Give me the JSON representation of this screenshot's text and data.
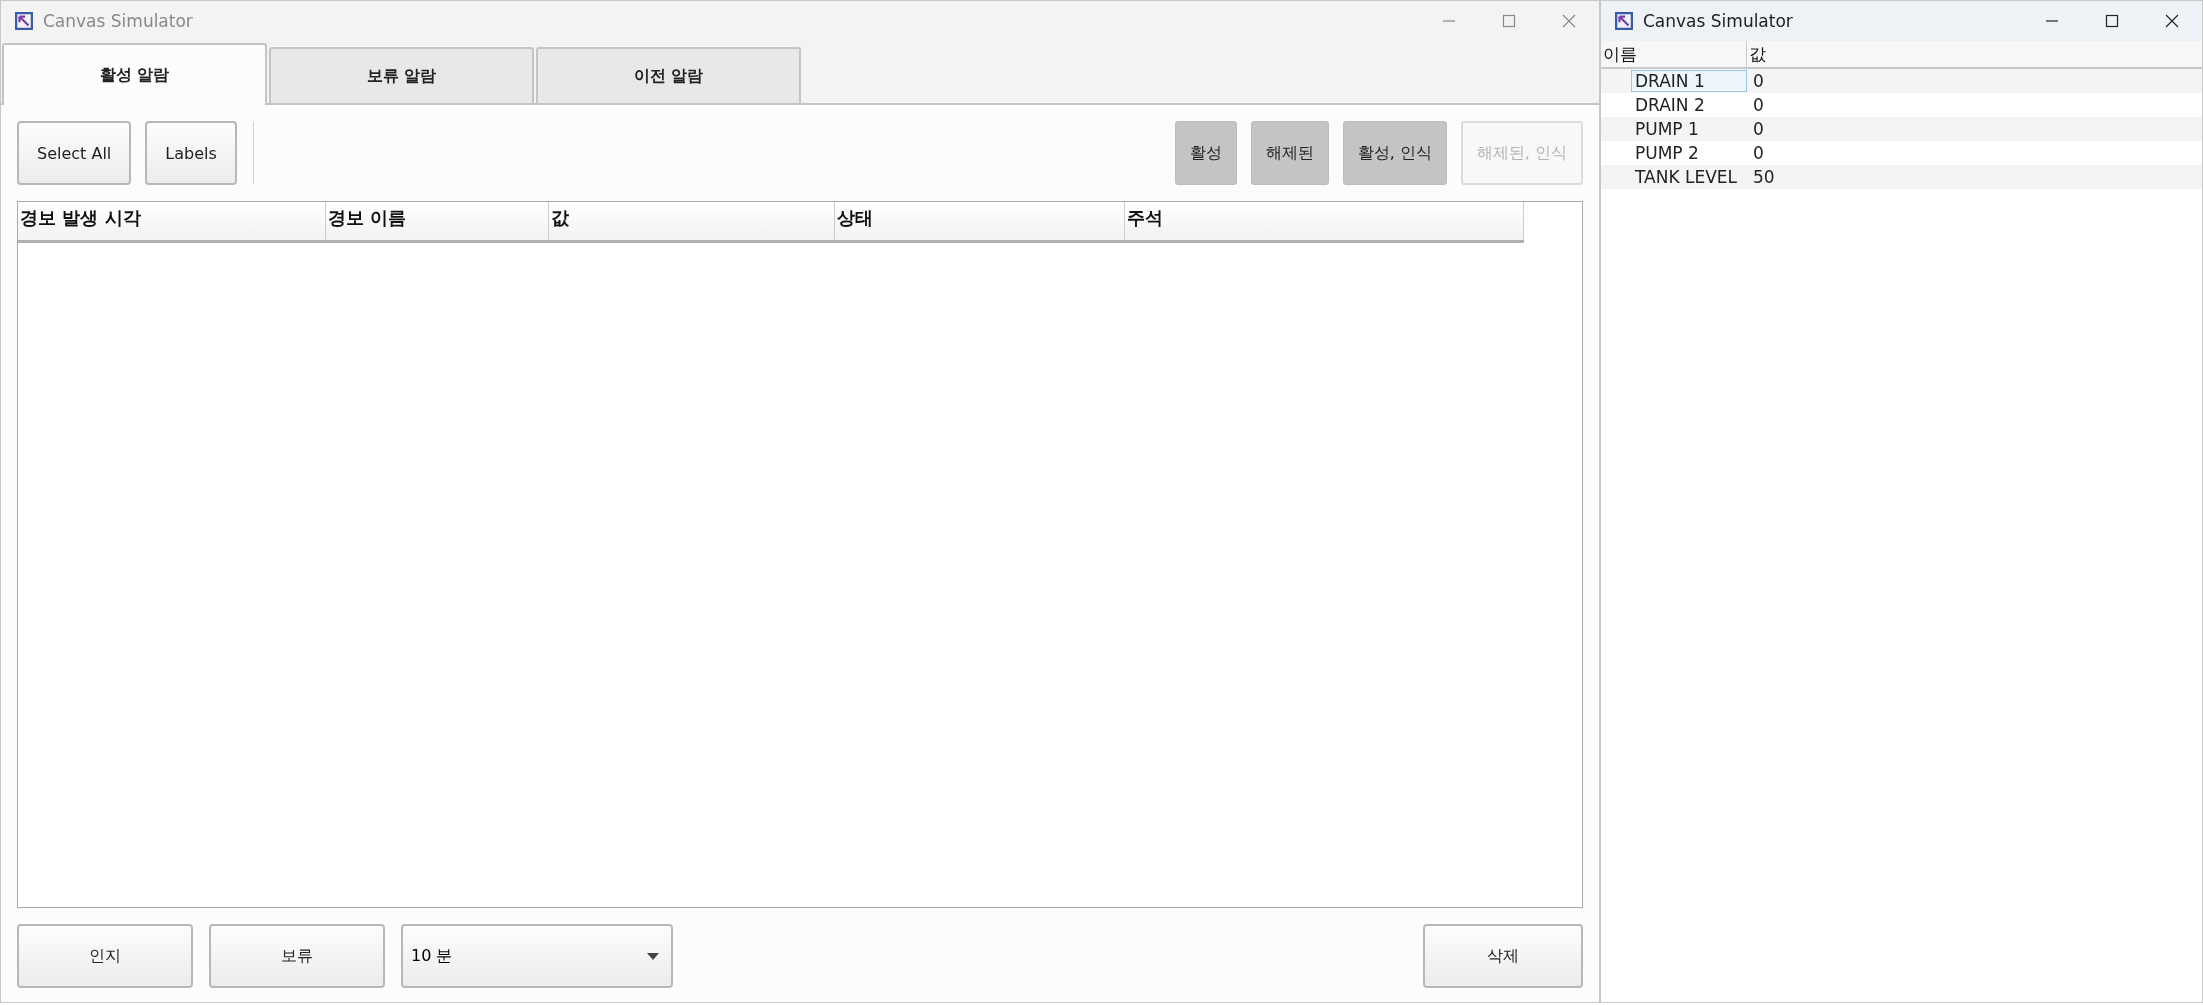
{
  "alarm_window": {
    "title": "Canvas Simulator",
    "tabs": [
      {
        "label": "활성 알람",
        "selected": true
      },
      {
        "label": "보류 알람",
        "selected": false
      },
      {
        "label": "이전 알람",
        "selected": false
      }
    ],
    "toolbar_buttons": [
      "Select All",
      "Labels"
    ],
    "filters": [
      {
        "label": "활성",
        "selected": true
      },
      {
        "label": "해제된",
        "selected": true
      },
      {
        "label": "활성, 인식",
        "selected": true
      },
      {
        "label": "해제된, 인식",
        "selected": false
      }
    ],
    "table": {
      "columns": [
        "경보 발생 시각",
        "경보 이름",
        "값",
        "상태",
        "주석"
      ]
    },
    "bottom_buttons": [
      "인지",
      "보류"
    ],
    "duration": {
      "value": "10 분"
    },
    "delete_button": "삭제"
  },
  "tag_window": {
    "title": "Canvas Simulator",
    "columns": [
      "이름",
      "값"
    ],
    "rows": [
      {
        "name": "DRAIN 1",
        "value": "0",
        "selected": true
      },
      {
        "name": "DRAIN 2",
        "value": "0",
        "selected": false
      },
      {
        "name": "PUMP 1",
        "value": "0",
        "selected": false
      },
      {
        "name": "PUMP 2",
        "value": "0",
        "selected": false
      },
      {
        "name": "TANK LEVEL",
        "value": "50",
        "selected": false
      }
    ]
  }
}
